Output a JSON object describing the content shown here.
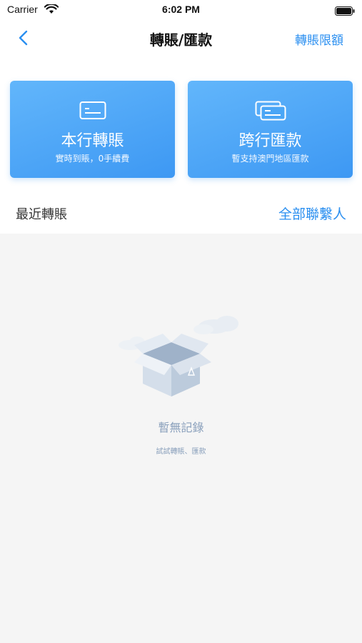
{
  "status_bar": {
    "carrier": "Carrier",
    "time": "6:02 PM"
  },
  "nav": {
    "title": "轉賬/匯款",
    "right_link": "轉賬限額"
  },
  "cards": [
    {
      "title": "本行轉賬",
      "subtitle": "實時到賬，0手續費",
      "icon": "card-transfer-icon"
    },
    {
      "title": "跨行匯款",
      "subtitle": "暫支持澳門地區匯款",
      "icon": "cards-remit-icon"
    }
  ],
  "recent": {
    "title": "最近轉賬",
    "link": "全部聯繫人"
  },
  "empty": {
    "title": "暫無記錄",
    "subtitle": "試試轉賬、匯款"
  },
  "colors": {
    "accent": "#2b8ff0",
    "card_gradient_start": "#62b6fb",
    "card_gradient_end": "#3d98f3",
    "empty_background": "#f5f5f5",
    "empty_text": "#8aa0bc"
  }
}
